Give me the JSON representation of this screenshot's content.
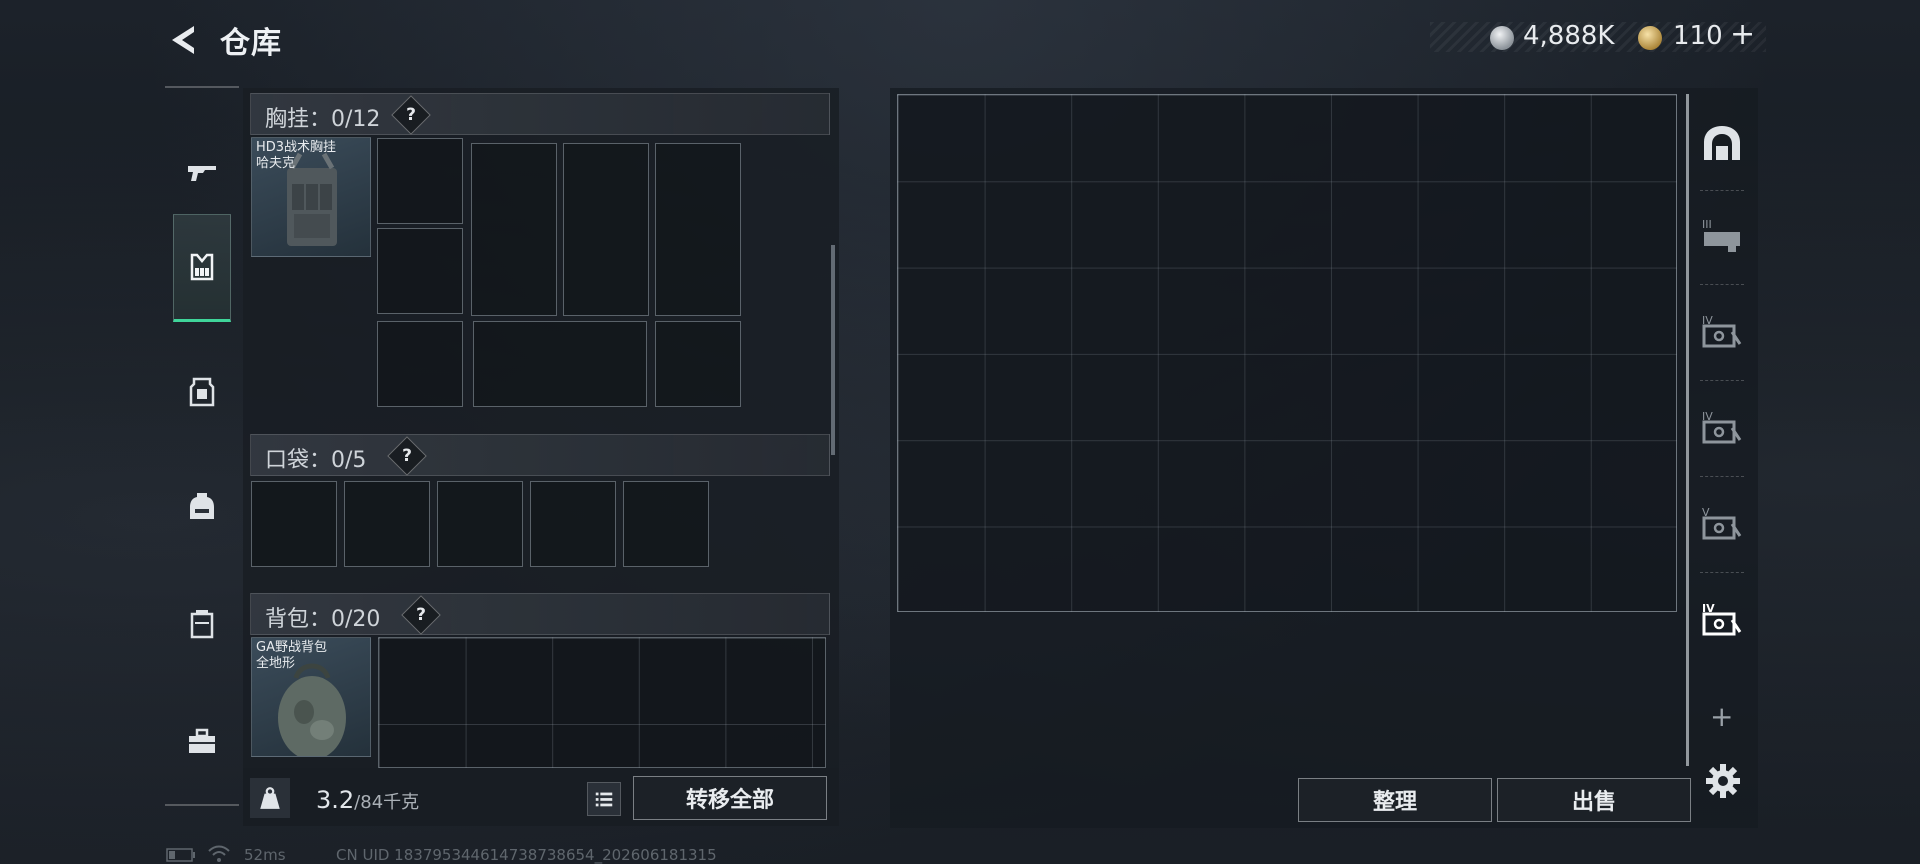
{
  "header": {
    "title": "仓库",
    "currency": {
      "coins_value": "4,888K",
      "tokens_value": "110",
      "plus": "+"
    }
  },
  "rail": {
    "items": [
      "weapon-icon",
      "chest-rig-icon",
      "armor-icon",
      "backpack-icon",
      "container-icon",
      "toolbox-icon"
    ],
    "active_index": 1
  },
  "equipment": {
    "chest_rig": {
      "label": "胸挂：0/12",
      "help": "?",
      "item_name": "HD3战术胸挂\n哈夫克"
    },
    "pockets": {
      "label": "口袋：0/5",
      "help": "?"
    },
    "backpack": {
      "label": "背包：0/20",
      "help": "?",
      "item_name": "GA野战背包\n全地形"
    }
  },
  "footer": {
    "weight_value": "3.2",
    "weight_capacity": "/84千克",
    "transfer_all": "转移全部"
  },
  "storage": {
    "sort_label": "整理",
    "sell_label": "出售",
    "tabs": [
      "main-stash-icon",
      "stash-III-icon",
      "stash-IV-icon",
      "stash-IV-icon",
      "stash-V-icon",
      "stash-IV-icon"
    ],
    "add": "+"
  },
  "status_bar": {
    "ping": "52ms",
    "uid": "CN UID 183795344614738738654_202606181315"
  },
  "colors": {
    "accent": "#3fd59a",
    "panel": "#181d23",
    "border": "#969fa8"
  }
}
